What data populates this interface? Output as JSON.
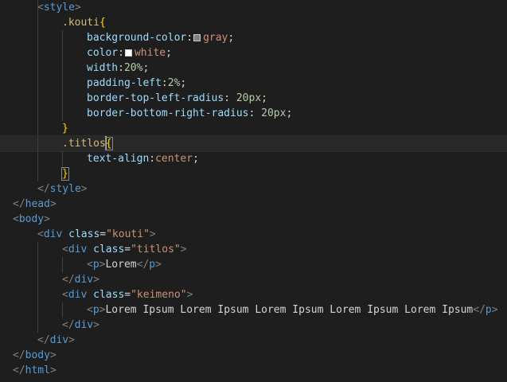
{
  "editor": {
    "language": "html",
    "colors": {
      "gray_swatch": "#808080",
      "white_swatch": "#ffffff"
    },
    "lines": [
      {
        "indent": 1,
        "guides": [
          1
        ],
        "tokens": [
          {
            "c": "t-brk",
            "t": "<"
          },
          {
            "c": "t-tag",
            "t": "style"
          },
          {
            "c": "t-brk",
            "t": ">"
          }
        ]
      },
      {
        "indent": 2,
        "guides": [
          1
        ],
        "tokens": [
          {
            "c": "t-sel",
            "t": ".kouti"
          },
          {
            "c": "t-brace",
            "t": "{"
          }
        ]
      },
      {
        "indent": 3,
        "guides": [
          1,
          2
        ],
        "tokens": [
          {
            "c": "t-prop",
            "t": "background-color"
          },
          {
            "c": "t-txt",
            "t": ":"
          },
          {
            "swatch": "gray_swatch"
          },
          {
            "c": "t-val",
            "t": "gray"
          },
          {
            "c": "t-txt",
            "t": ";"
          }
        ]
      },
      {
        "indent": 3,
        "guides": [
          1,
          2
        ],
        "tokens": [
          {
            "c": "t-prop",
            "t": "color"
          },
          {
            "c": "t-txt",
            "t": ":"
          },
          {
            "swatch": "white_swatch"
          },
          {
            "c": "t-val",
            "t": "white"
          },
          {
            "c": "t-txt",
            "t": ";"
          }
        ]
      },
      {
        "indent": 3,
        "guides": [
          1,
          2
        ],
        "tokens": [
          {
            "c": "t-prop",
            "t": "width"
          },
          {
            "c": "t-txt",
            "t": ":"
          },
          {
            "c": "t-num",
            "t": "20%"
          },
          {
            "c": "t-txt",
            "t": ";"
          }
        ]
      },
      {
        "indent": 3,
        "guides": [
          1,
          2
        ],
        "tokens": [
          {
            "c": "t-prop",
            "t": "padding-left"
          },
          {
            "c": "t-txt",
            "t": ":"
          },
          {
            "c": "t-num",
            "t": "2%"
          },
          {
            "c": "t-txt",
            "t": ";"
          }
        ]
      },
      {
        "indent": 3,
        "guides": [
          1,
          2
        ],
        "tokens": [
          {
            "c": "t-prop",
            "t": "border-top-left-radius"
          },
          {
            "c": "t-txt",
            "t": ": "
          },
          {
            "c": "t-num",
            "t": "20px"
          },
          {
            "c": "t-txt",
            "t": ";"
          }
        ]
      },
      {
        "indent": 3,
        "guides": [
          1,
          2
        ],
        "tokens": [
          {
            "c": "t-prop",
            "t": "border-bottom-right-radius"
          },
          {
            "c": "t-txt",
            "t": ": "
          },
          {
            "c": "t-num",
            "t": "20px"
          },
          {
            "c": "t-txt",
            "t": ";"
          }
        ]
      },
      {
        "indent": 2,
        "guides": [
          1
        ],
        "tokens": [
          {
            "c": "t-brace",
            "t": "}"
          }
        ]
      },
      {
        "indent": 2,
        "guides": [
          1
        ],
        "active": true,
        "tokens": [
          {
            "c": "t-sel",
            "t": ".titlos"
          },
          {
            "cursor": true
          },
          {
            "c": "t-brace-match",
            "t": "{"
          }
        ]
      },
      {
        "indent": 3,
        "guides": [
          1,
          2
        ],
        "tokens": [
          {
            "c": "t-prop",
            "t": "text-align"
          },
          {
            "c": "t-txt",
            "t": ":"
          },
          {
            "c": "t-val",
            "t": "center"
          },
          {
            "c": "t-txt",
            "t": ";"
          }
        ]
      },
      {
        "indent": 2,
        "guides": [
          1
        ],
        "tokens": [
          {
            "c": "t-brace-match",
            "t": "}"
          }
        ]
      },
      {
        "indent": 1,
        "guides": [],
        "tokens": [
          {
            "c": "t-brk",
            "t": "</"
          },
          {
            "c": "t-tag",
            "t": "style"
          },
          {
            "c": "t-brk",
            "t": ">"
          }
        ]
      },
      {
        "indent": 0,
        "guides": [],
        "tokens": [
          {
            "c": "t-brk",
            "t": "</"
          },
          {
            "c": "t-tag",
            "t": "head"
          },
          {
            "c": "t-brk",
            "t": ">"
          }
        ]
      },
      {
        "indent": 0,
        "guides": [],
        "tokens": [
          {
            "c": "t-brk",
            "t": "<"
          },
          {
            "c": "t-tag",
            "t": "body"
          },
          {
            "c": "t-brk",
            "t": ">"
          }
        ]
      },
      {
        "indent": 1,
        "guides": [],
        "tokens": [
          {
            "c": "t-brk",
            "t": "<"
          },
          {
            "c": "t-tag",
            "t": "div"
          },
          {
            "c": "t-txt",
            "t": " "
          },
          {
            "c": "t-attr",
            "t": "class"
          },
          {
            "c": "t-txt",
            "t": "="
          },
          {
            "c": "t-str",
            "t": "\"kouti\""
          },
          {
            "c": "t-brk",
            "t": ">"
          }
        ]
      },
      {
        "indent": 2,
        "guides": [
          1
        ],
        "tokens": [
          {
            "c": "t-brk",
            "t": "<"
          },
          {
            "c": "t-tag",
            "t": "div"
          },
          {
            "c": "t-txt",
            "t": " "
          },
          {
            "c": "t-attr",
            "t": "class"
          },
          {
            "c": "t-txt",
            "t": "="
          },
          {
            "c": "t-str",
            "t": "\"titlos\""
          },
          {
            "c": "t-brk",
            "t": ">"
          }
        ]
      },
      {
        "indent": 3,
        "guides": [
          1,
          2
        ],
        "tokens": [
          {
            "c": "t-brk",
            "t": "<"
          },
          {
            "c": "t-tag",
            "t": "p"
          },
          {
            "c": "t-brk",
            "t": ">"
          },
          {
            "c": "t-txt",
            "t": "Lorem"
          },
          {
            "c": "t-brk",
            "t": "</"
          },
          {
            "c": "t-tag",
            "t": "p"
          },
          {
            "c": "t-brk",
            "t": ">"
          }
        ]
      },
      {
        "indent": 2,
        "guides": [
          1
        ],
        "tokens": [
          {
            "c": "t-brk",
            "t": "</"
          },
          {
            "c": "t-tag",
            "t": "div"
          },
          {
            "c": "t-brk",
            "t": ">"
          }
        ]
      },
      {
        "indent": 2,
        "guides": [
          1
        ],
        "tokens": [
          {
            "c": "t-brk",
            "t": "<"
          },
          {
            "c": "t-tag",
            "t": "div"
          },
          {
            "c": "t-txt",
            "t": " "
          },
          {
            "c": "t-attr",
            "t": "class"
          },
          {
            "c": "t-txt",
            "t": "="
          },
          {
            "c": "t-str",
            "t": "\"keimeno\""
          },
          {
            "c": "t-brk",
            "t": ">"
          }
        ]
      },
      {
        "indent": 3,
        "guides": [
          1,
          2
        ],
        "tokens": [
          {
            "c": "t-brk",
            "t": "<"
          },
          {
            "c": "t-tag",
            "t": "p"
          },
          {
            "c": "t-brk",
            "t": ">"
          },
          {
            "c": "t-txt",
            "t": "Lorem Ipsum Lorem Ipsum Lorem Ipsum Lorem Ipsum Lorem Ipsum"
          },
          {
            "c": "t-brk",
            "t": "</"
          },
          {
            "c": "t-tag",
            "t": "p"
          },
          {
            "c": "t-brk",
            "t": ">"
          }
        ]
      },
      {
        "indent": 2,
        "guides": [
          1
        ],
        "tokens": [
          {
            "c": "t-brk",
            "t": "</"
          },
          {
            "c": "t-tag",
            "t": "div"
          },
          {
            "c": "t-brk",
            "t": ">"
          }
        ]
      },
      {
        "indent": 1,
        "guides": [],
        "tokens": [
          {
            "c": "t-brk",
            "t": "</"
          },
          {
            "c": "t-tag",
            "t": "div"
          },
          {
            "c": "t-brk",
            "t": ">"
          }
        ]
      },
      {
        "indent": 0,
        "guides": [],
        "tokens": [
          {
            "c": "t-brk",
            "t": "</"
          },
          {
            "c": "t-tag",
            "t": "body"
          },
          {
            "c": "t-brk",
            "t": ">"
          }
        ]
      },
      {
        "indent": 0,
        "guides": [],
        "tokens": [
          {
            "c": "t-brk",
            "t": "</"
          },
          {
            "c": "t-tag",
            "t": "html"
          },
          {
            "c": "t-brk",
            "t": ">"
          }
        ]
      }
    ]
  }
}
